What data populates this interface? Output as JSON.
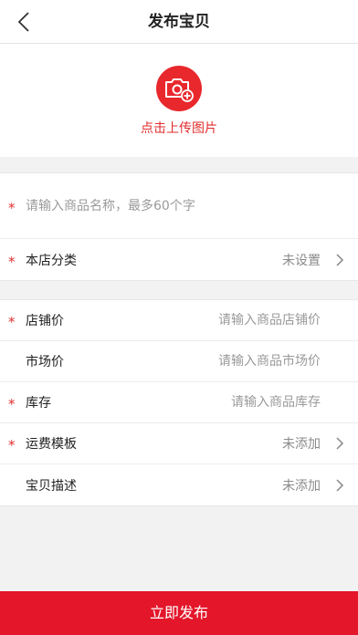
{
  "header": {
    "title": "发布宝贝"
  },
  "upload": {
    "label": "点击上传图片"
  },
  "product_name": {
    "required": "*",
    "placeholder": "请输入商品名称，最多60个字"
  },
  "category": {
    "required": "*",
    "label": "本店分类",
    "value": "未设置"
  },
  "fields": {
    "store_price": {
      "required": "*",
      "label": "店铺价",
      "placeholder": "请输入商品店铺价"
    },
    "market_price": {
      "label": "市场价",
      "placeholder": "请输入商品市场价"
    },
    "stock": {
      "required": "*",
      "label": "库存",
      "placeholder": "请输入商品库存"
    },
    "shipping": {
      "required": "*",
      "label": "运费模板",
      "value": "未添加"
    },
    "description": {
      "label": "宝贝描述",
      "value": "未添加"
    }
  },
  "footer": {
    "publish_label": "立即发布"
  },
  "colors": {
    "accent": "#e3162a",
    "required_star": "#e12e2e",
    "background": "#f2f2f2"
  },
  "icons": {
    "back": "chevron-left-icon",
    "camera": "camera-plus-icon",
    "row_arrow": "chevron-right-icon"
  }
}
